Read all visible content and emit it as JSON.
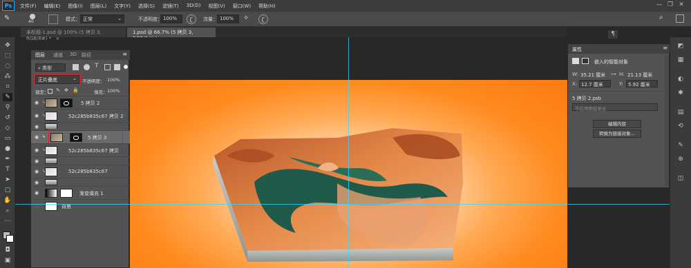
{
  "app": {
    "logo": "Ps"
  },
  "menu": [
    "文件(F)",
    "编辑(E)",
    "图像(I)",
    "图层(L)",
    "文字(Y)",
    "选择(S)",
    "滤镜(T)",
    "3D(D)",
    "视图(V)",
    "窗口(W)",
    "帮助(H)"
  ],
  "window_controls": [
    "—",
    "❐",
    "✕"
  ],
  "options": {
    "brush_size": "40",
    "mode_label": "模式：",
    "mode_value": "正常",
    "opacity_label": "不透明度：",
    "opacity_value": "100%",
    "flow_label": "流量：",
    "flow_value": "100%"
  },
  "tabs": [
    {
      "label": "未标题-1.psd @ 100% (5 拷贝 3, RGB/8#) *",
      "close": "×"
    },
    {
      "label": "1.psd @ 66.7% (5 拷贝 3, RGB/8#) *",
      "close": "×"
    }
  ],
  "layers_panel": {
    "tabs": [
      "图层",
      "通道",
      "3D",
      "路径"
    ],
    "kind_label": "类型",
    "blend_mode": "正片叠底",
    "opacity_label": "不透明度：",
    "opacity_value": "100%",
    "lock_label": "锁定：",
    "fill_label": "填充：",
    "fill_value": "100%",
    "layers": [
      {
        "name": "5 拷贝 2",
        "selected": false
      },
      {
        "name": "52c285b835c67 拷贝 2",
        "selected": false
      },
      {
        "name": "",
        "selected": false
      },
      {
        "name": "5 拷贝 3",
        "selected": true
      },
      {
        "name": "52c285b835c67 拷贝",
        "selected": false
      },
      {
        "name": "",
        "selected": false
      },
      {
        "name": "52c285b835c67",
        "selected": false
      },
      {
        "name": "",
        "selected": false
      },
      {
        "name": "渐变填充 1",
        "selected": false
      },
      {
        "name": "背景",
        "selected": false
      }
    ]
  },
  "properties_panel": {
    "title": "属性",
    "object_type": "嵌入的智能对象",
    "w_label": "W:",
    "w_value": "35.21 厘米",
    "h_label": "H:",
    "h_value": "21.13 厘米",
    "x_label": "X:",
    "x_value": "12.7 厘米",
    "y_label": "Y:",
    "y_value": "5.92 厘米",
    "source": "5 拷贝 2.psb",
    "comp_placeholder": "不应用图层复合",
    "edit_button": "编辑内容",
    "convert_button": "转换为链接对象..."
  },
  "colors": {
    "accent_guide": "#3ad6ff",
    "canvas_orange": "#ff8a1e",
    "highlight_red": "#e02020"
  }
}
